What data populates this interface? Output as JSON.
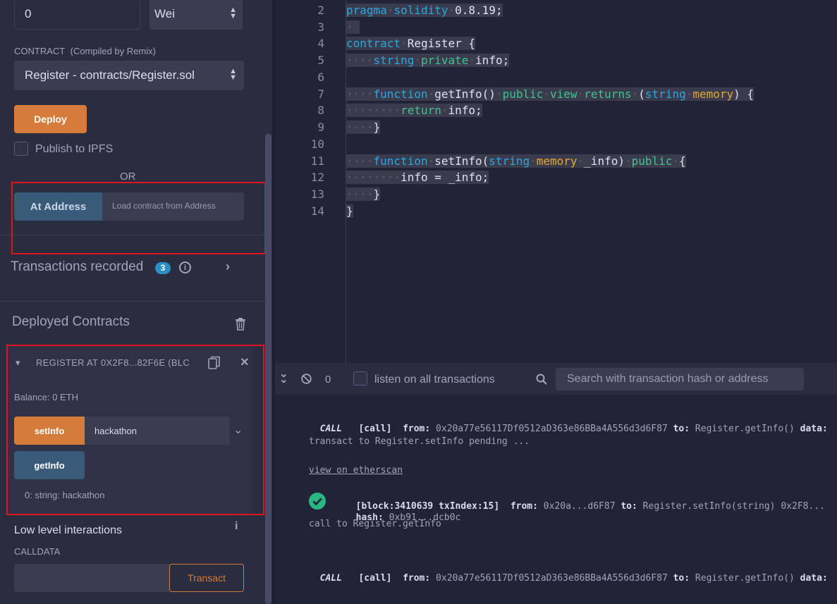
{
  "left": {
    "value_input": "0",
    "unit_select": "Wei",
    "contract_label": "CONTRACT",
    "contract_sub": "(Compiled by Remix)",
    "contract_select": "Register - contracts/Register.sol",
    "deploy": "Deploy",
    "publish_ipfs": "Publish to IPFS",
    "or": "OR",
    "at_address": "At Address",
    "at_address_placeholder": "Load contract from Address",
    "transactions_recorded": "Transactions recorded",
    "tx_count": "3",
    "deployed_contracts": "Deployed Contracts",
    "instance_title": "REGISTER AT 0X2F8...82F6E (BLC",
    "balance": "Balance: 0 ETH",
    "setinfo": "setInfo",
    "setinfo_value": "hackathon",
    "getinfo": "getInfo",
    "getinfo_result": "0: string: hackathon",
    "low_level": "Low level interactions",
    "calldata": "CALLDATA",
    "transact": "Transact"
  },
  "editor": {
    "lines": [
      {
        "n": "2"
      },
      {
        "n": "3"
      },
      {
        "n": "4"
      },
      {
        "n": "5"
      },
      {
        "n": "6"
      },
      {
        "n": "7"
      },
      {
        "n": "8"
      },
      {
        "n": "9"
      },
      {
        "n": "10"
      },
      {
        "n": "11"
      },
      {
        "n": "12"
      },
      {
        "n": "13"
      },
      {
        "n": "14"
      }
    ],
    "t_pragma": "pragma",
    "t_solidity": "solidity",
    "t_version": "0.8.19;",
    "t_contract": "contract",
    "t_register": "Register {",
    "t_string": "string",
    "t_private": "private",
    "t_info_decl": "info;",
    "t_function": "function",
    "t_getinfo_sig": "getInfo()",
    "t_public": "public",
    "t_view": "view",
    "t_returns": "returns",
    "t_paren_open": "(",
    "t_memory": "memory",
    "t_paren_close_brace": ") {",
    "t_return": "return",
    "t_return_val": "info;",
    "t_close": "}",
    "t_setinfo_sig": "setInfo(",
    "t_param": "_info)",
    "t_brace": "{",
    "t_assign": "info = _info;"
  },
  "terminal": {
    "count": "0",
    "listen": "listen on all transactions",
    "search_placeholder": "Search with transaction hash or address",
    "log1_call": "CALL",
    "log1_body": "[call]",
    "from_label": "from:",
    "log1_from": "0x20a77e56117Df0512aD363e86BBa4A556d3d6F87",
    "to_label": "to:",
    "log1_to": "Register.getInfo()",
    "data_label": "data:",
    "pending": "transact to Register.setInfo pending ...",
    "etherscan": "view on etherscan",
    "block": "[block:3410639 txIndex:15]",
    "log2_from": "0x20a...d6F87",
    "log2_to": "Register.setInfo(string) 0x2F8...",
    "hash_label": "hash:",
    "hash": "0xb91...dcb0c",
    "call_to": "call to Register.getInfo",
    "log3_call": "CALL",
    "log3_body": "[call]",
    "log3_from": "0x20a77e56117Df0512aD363e86BBa4A556d3d6F87",
    "log3_to": "Register.getInfo()"
  },
  "colors": {
    "accent_orange": "#d57c3b",
    "button_blue": "#3a5a7a",
    "highlight_red": "#e0141e",
    "badge": "#2a8fc4",
    "success_green": "#29b782"
  }
}
